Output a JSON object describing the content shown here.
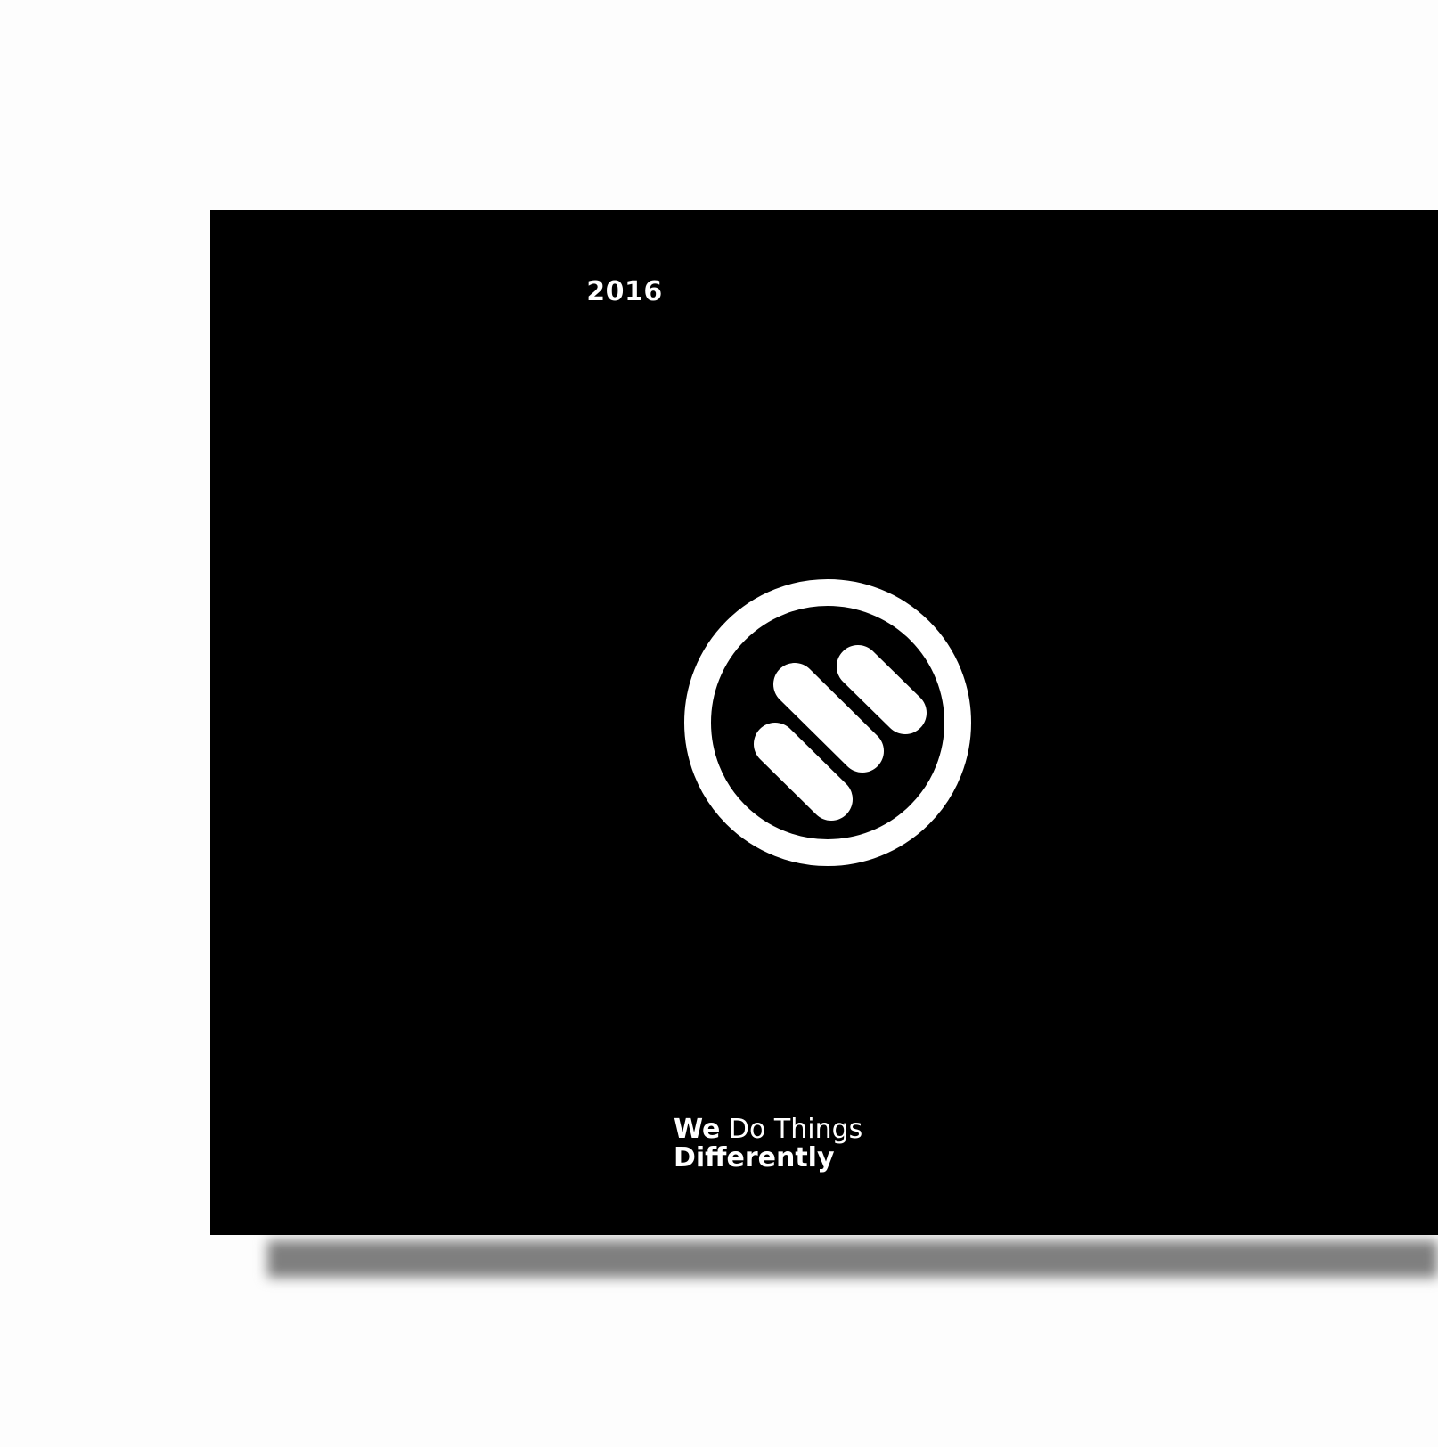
{
  "cover": {
    "year": "2016",
    "tagline": {
      "line1_bold": "We",
      "line1_regular": " Do Things",
      "line2_bold": "Differently"
    }
  },
  "logo": {
    "icon": "brand-circle-logo-icon",
    "color": "#ffffff"
  },
  "colors": {
    "background": "#fdfdfd",
    "card": "#000000",
    "text": "#ffffff",
    "shadow": "#7f7f7f"
  }
}
